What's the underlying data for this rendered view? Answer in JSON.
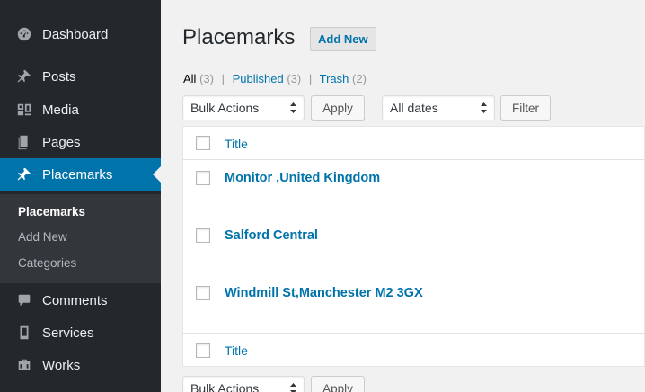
{
  "sidebar": {
    "items": [
      {
        "label": "Dashboard",
        "icon": "dashboard-icon"
      },
      {
        "label": "Posts",
        "icon": "pin-icon"
      },
      {
        "label": "Media",
        "icon": "media-icon"
      },
      {
        "label": "Pages",
        "icon": "pages-icon"
      },
      {
        "label": "Placemarks",
        "icon": "pin-icon"
      },
      {
        "label": "Comments",
        "icon": "comment-icon"
      },
      {
        "label": "Services",
        "icon": "tablet-icon"
      },
      {
        "label": "Works",
        "icon": "portfolio-icon"
      }
    ],
    "submenu": [
      "Placemarks",
      "Add New",
      "Categories"
    ]
  },
  "header": {
    "title": "Placemarks",
    "add_new": "Add New"
  },
  "filters": {
    "all": "All",
    "all_count": "(3)",
    "published": "Published",
    "published_count": "(3)",
    "trash": "Trash",
    "trash_count": "(2)",
    "separator": "|"
  },
  "toolbar": {
    "bulk_actions": "Bulk Actions",
    "apply": "Apply",
    "dates": "All dates",
    "filter": "Filter"
  },
  "table": {
    "column_title": "Title",
    "rows": [
      "Monitor ,United Kingdom",
      "Salford Central",
      "Windmill St,Manchester M2 3GX"
    ]
  },
  "colors": {
    "sidebar_bg": "#23282d",
    "accent": "#0073aa",
    "submenu_bg": "#32373c",
    "page_bg": "#f1f1f1"
  }
}
